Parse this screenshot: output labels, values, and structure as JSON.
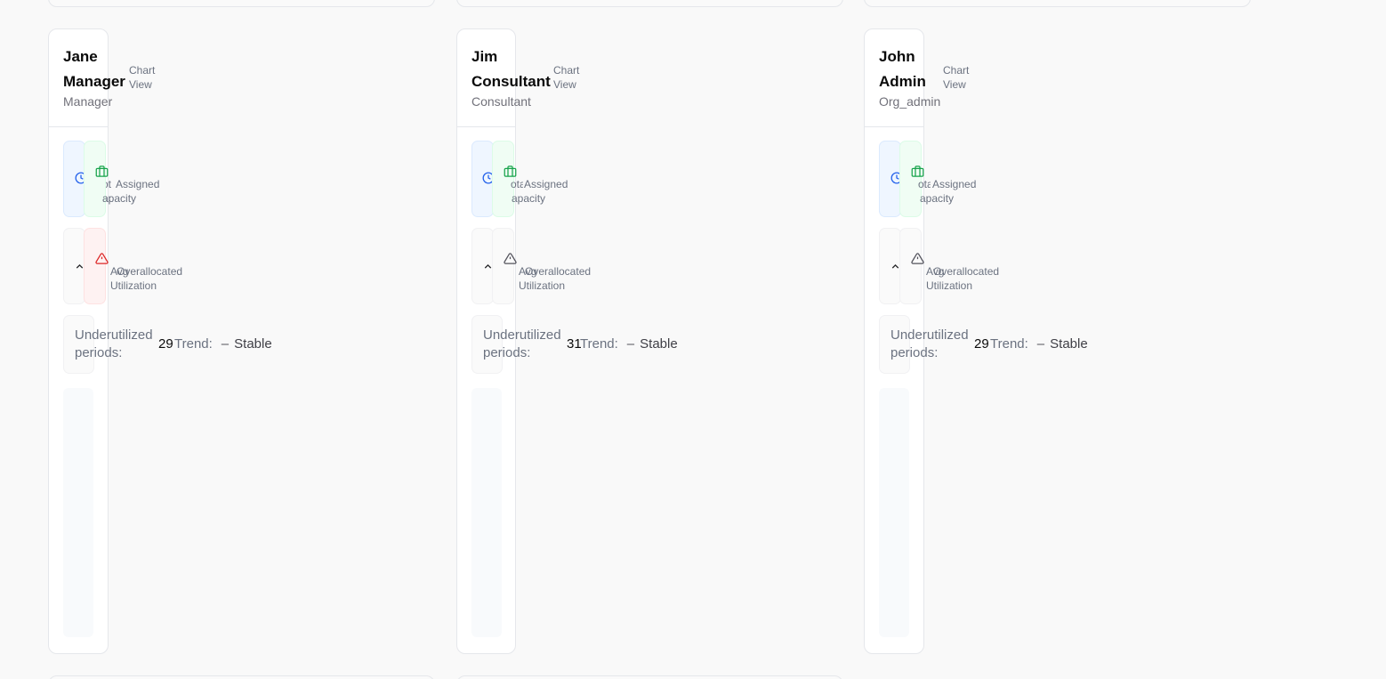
{
  "chart_view_label": [
    "Chart",
    "View"
  ],
  "labels": {
    "total_capacity": [
      "otal",
      "apacity"
    ],
    "assigned": "Assigned",
    "avg_utilization": [
      "Avg",
      "Utilization"
    ],
    "overallocated": "Overallocated",
    "underutilized": [
      "Underutilized",
      "periods:"
    ],
    "trend": "Trend:"
  },
  "trend_dash": "–",
  "colors": {
    "capacity_icon": "#2563eb",
    "assigned_icon": "#16a34a",
    "warning_active": "#dc2626",
    "warning_inactive": "#52525b"
  },
  "cards": [
    {
      "name": [
        "Jane",
        "Manager"
      ],
      "role": "Manager",
      "underutilized_periods": "29",
      "trend_value": "Stable",
      "overallocated_active": true
    },
    {
      "name": [
        "Jim",
        "Consultant"
      ],
      "role": "Consultant",
      "underutilized_periods": "31",
      "trend_value": "Stable",
      "overallocated_active": false
    },
    {
      "name": [
        "John",
        "Admin"
      ],
      "role": "Org_admin",
      "underutilized_periods": "29",
      "trend_value": "Stable",
      "overallocated_active": false
    }
  ]
}
